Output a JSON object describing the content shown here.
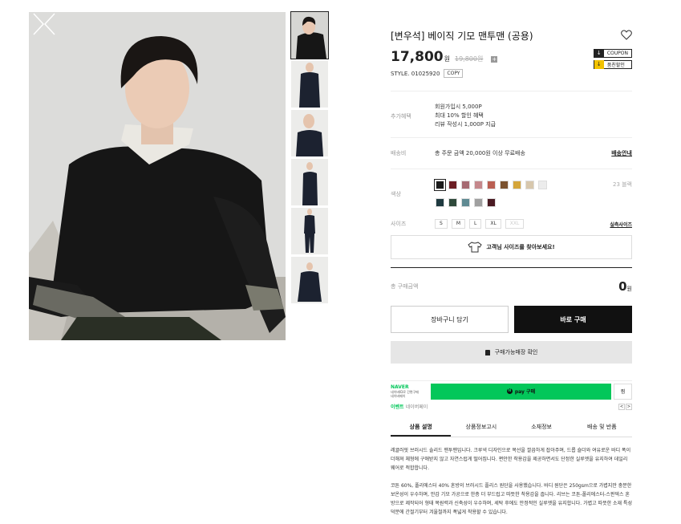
{
  "product": {
    "title": "[변우석] 베이직 기모 맨투맨 (공용)",
    "price": "17,800",
    "price_unit": "원",
    "original_price": "19,800원",
    "plus_symbol": "+",
    "style_label": "STYLE. 01025920",
    "copy_label": "COPY"
  },
  "badges": [
    {
      "icon": "↓",
      "label": "COUPON"
    },
    {
      "icon": "↓",
      "label": "품친할인"
    }
  ],
  "benefits": {
    "label": "추가혜택",
    "lines": [
      "회원가입시 5,000P",
      "최대 10% 할인 혜택",
      "리뷰 작성시 1,000P 지급"
    ]
  },
  "shipping": {
    "label": "배송비",
    "text": "총 주문 금액 20,000원 이상 무료배송",
    "link": "배송안내"
  },
  "colors": {
    "label": "색상",
    "count": "23 블랙",
    "swatches": [
      "#1b1b1b",
      "#6b1e24",
      "#a56a72",
      "#c5888c",
      "#b95f52",
      "#7a5230",
      "#d4a53a",
      "#d7c7ad",
      "#ececec",
      "#1f3a40",
      "#2f4a3b",
      "#5f8a92",
      "#a0a0a0",
      "#4a1a22"
    ]
  },
  "sizes": {
    "label": "사이즈",
    "options": [
      "S",
      "M",
      "L",
      "XL",
      "XXL"
    ],
    "link": "실측사이즈"
  },
  "fit_finder": "고객님 사이즈를 찾아보세요!",
  "total": {
    "label": "총 구매금액",
    "amount": "0",
    "unit": "원"
  },
  "actions": {
    "cart": "장바구니 담기",
    "buy": "바로 구매",
    "store": "구매가능매장 확인"
  },
  "naver": {
    "brand": "NAVER",
    "sub1": "네이버ID로 간편구매",
    "sub2": "네이버페이",
    "pay_label": "pay 구매",
    "pay_icon": "N",
    "side": "찜",
    "event": "이벤트",
    "event_sub": "네이버페이",
    "prev": "<",
    "next": ">"
  },
  "tabs": [
    "상품 설명",
    "상품정보고시",
    "소재정보",
    "배송 및 반품"
  ],
  "description": [
    "레귤러핏 브러시드 솔리드 맨투맨입니다. 크루넥 디자인으로 목선을 깔끔하게 잡아주며, 드롭 숄더와 여유로운 바디 폭이 더해져 체형에 구애받지 않고 자연스럽게 떨어집니다. 편안한 착용감을 제공하면서도 단정한 실루엣을 유지하여 데일리 웨어로 적합합니다.",
    "코튼 60%, 폴리에스터 40% 혼방의 브러시드 플리스 원단을 사용했습니다. 바디 원단은 250gsm으로 가볍지만 충분한 보온성이 우수하며, 안감 기모 가공으로 한층 더 부드럽고 따뜻한 착용감을 줍니다. 리브는 코튼-폴리에스터-스판덱스 혼방으로 제작되어 형태 복원력과 신축성이 우수하며, 세탁 후에도 안정적인 실루엣을 유지합니다. 가볍고 따뜻한 소재 특성 덕분에 간절기부터 겨울철까지 폭넓게 착용할 수 있습니다."
  ]
}
